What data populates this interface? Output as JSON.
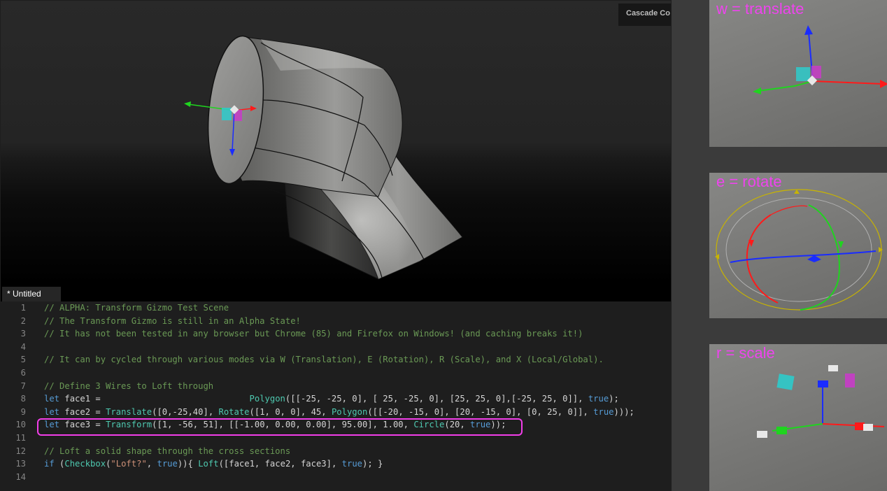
{
  "viewport": {
    "scene_label": "Cascade Co"
  },
  "editor": {
    "tab_label": "* Untitled",
    "lines": [
      {
        "num": "1",
        "tokens": [
          {
            "t": "c",
            "v": "// ALPHA: Transform Gizmo Test Scene"
          }
        ]
      },
      {
        "num": "2",
        "tokens": [
          {
            "t": "c",
            "v": "// The Transform Gizmo is still in an Alpha State!"
          }
        ]
      },
      {
        "num": "3",
        "tokens": [
          {
            "t": "c",
            "v": "// It has not been tested in any browser but Chrome (85) and Firefox on Windows! (and caching breaks it!)"
          }
        ]
      },
      {
        "num": "4",
        "tokens": []
      },
      {
        "num": "5",
        "tokens": [
          {
            "t": "c",
            "v": "// It can by cycled through various modes via W (Translation), E (Rotation), R (Scale), and X (Local/Global)."
          }
        ]
      },
      {
        "num": "6",
        "tokens": []
      },
      {
        "num": "7",
        "tokens": [
          {
            "t": "c",
            "v": "// Define 3 Wires to Loft through"
          }
        ]
      },
      {
        "num": "8",
        "tokens": [
          {
            "t": "k",
            "v": "let"
          },
          {
            "t": "p",
            "v": " face1 =                             "
          },
          {
            "t": "f",
            "v": "Polygon"
          },
          {
            "t": "p",
            "v": "([[-25, -25, 0], [ 25, -25, 0], [25, 25, 0],[-25, 25, 0]], "
          },
          {
            "t": "k",
            "v": "true"
          },
          {
            "t": "p",
            "v": ");"
          }
        ]
      },
      {
        "num": "9",
        "tokens": [
          {
            "t": "k",
            "v": "let"
          },
          {
            "t": "p",
            "v": " face2 = "
          },
          {
            "t": "f",
            "v": "Translate"
          },
          {
            "t": "p",
            "v": "([0,-25,40], "
          },
          {
            "t": "f",
            "v": "Rotate"
          },
          {
            "t": "p",
            "v": "([1, 0, 0], 45, "
          },
          {
            "t": "f",
            "v": "Polygon"
          },
          {
            "t": "p",
            "v": "([[-20, -15, 0], [20, -15, 0], [0, 25, 0]], "
          },
          {
            "t": "k",
            "v": "true"
          },
          {
            "t": "p",
            "v": ")));"
          }
        ]
      },
      {
        "num": "10",
        "tokens": [
          {
            "t": "k",
            "v": "let"
          },
          {
            "t": "p",
            "v": " face3 = "
          },
          {
            "t": "f",
            "v": "Transform"
          },
          {
            "t": "p",
            "v": "([1, -56, 51], [[-1.00, 0.00, 0.00], 95.00], 1.00, "
          },
          {
            "t": "f",
            "v": "Circle"
          },
          {
            "t": "p",
            "v": "(20, "
          },
          {
            "t": "k",
            "v": "true"
          },
          {
            "t": "p",
            "v": "));"
          }
        ]
      },
      {
        "num": "11",
        "tokens": []
      },
      {
        "num": "12",
        "tokens": [
          {
            "t": "c",
            "v": "// Loft a solid shape through the cross sections"
          }
        ]
      },
      {
        "num": "13",
        "tokens": [
          {
            "t": "k",
            "v": "if"
          },
          {
            "t": "p",
            "v": " ("
          },
          {
            "t": "f",
            "v": "Checkbox"
          },
          {
            "t": "p",
            "v": "("
          },
          {
            "t": "s",
            "v": "\"Loft?\""
          },
          {
            "t": "p",
            "v": ", "
          },
          {
            "t": "k",
            "v": "true"
          },
          {
            "t": "p",
            "v": ")){ "
          },
          {
            "t": "f",
            "v": "Loft"
          },
          {
            "t": "p",
            "v": "([face1, face2, face3], "
          },
          {
            "t": "k",
            "v": "true"
          },
          {
            "t": "p",
            "v": "); }"
          }
        ]
      },
      {
        "num": "14",
        "tokens": []
      }
    ]
  },
  "panels": {
    "translate": {
      "label": "w = translate",
      "icon": "translate-gizmo-icon"
    },
    "rotate": {
      "label": "e = rotate",
      "icon": "rotate-gizmo-icon"
    },
    "scale": {
      "label": "r = scale",
      "icon": "scale-gizmo-icon"
    }
  },
  "colors": {
    "highlight_border": "#f23ee9",
    "panel_label": "#ee44ee",
    "axis_x": "#ff1a1a",
    "axis_y": "#1fd41f",
    "axis_z": "#1a2cff",
    "comment": "#6a9955",
    "keyword": "#569cd6",
    "function": "#4ec9b0"
  }
}
